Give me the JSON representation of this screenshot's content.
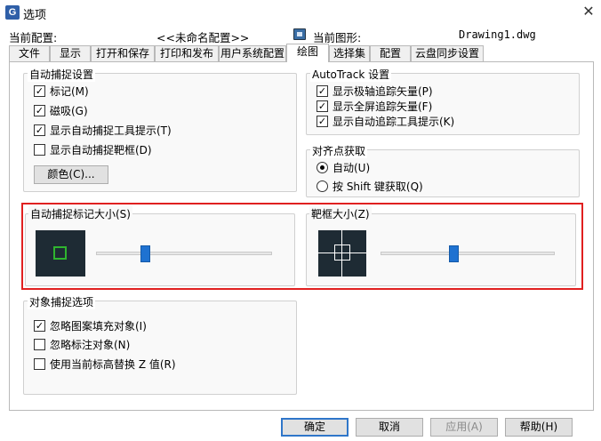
{
  "window": {
    "title": "选项",
    "close": "✕"
  },
  "header": {
    "profile_label": "当前配置:",
    "profile_value": "<<未命名配置>>",
    "drawing_label": "当前图形:",
    "drawing_value": "Drawing1.dwg"
  },
  "tabs": [
    {
      "label": "文件"
    },
    {
      "label": "显示"
    },
    {
      "label": "打开和保存"
    },
    {
      "label": "打印和发布"
    },
    {
      "label": "用户系统配置"
    },
    {
      "label": "绘图",
      "active": true
    },
    {
      "label": "选择集"
    },
    {
      "label": "配置"
    },
    {
      "label": "云盘同步设置"
    }
  ],
  "autosnap": {
    "title": "自动捕捉设置",
    "options": [
      {
        "label": "标记(M)",
        "checked": true
      },
      {
        "label": "磁吸(G)",
        "checked": true
      },
      {
        "label": "显示自动捕捉工具提示(T)",
        "checked": true
      },
      {
        "label": "显示自动捕捉靶框(D)",
        "checked": false
      }
    ],
    "color_button": "颜色(C)..."
  },
  "autotrack": {
    "title": "AutoTrack 设置",
    "options": [
      {
        "label": "显示极轴追踪矢量(P)",
        "checked": true
      },
      {
        "label": "显示全屏追踪矢量(F)",
        "checked": true
      },
      {
        "label": "显示自动追踪工具提示(K)",
        "checked": true
      }
    ]
  },
  "alignment": {
    "title": "对齐点获取",
    "options": [
      {
        "label": "自动(U)",
        "selected": true
      },
      {
        "label": "按 Shift 键获取(Q)",
        "selected": false
      }
    ]
  },
  "marker_size": {
    "title": "自动捕捉标记大小(S)",
    "level": 0.28
  },
  "aperture_size": {
    "title": "靶框大小(Z)",
    "level": 0.42
  },
  "object_snap": {
    "title": "对象捕捉选项",
    "options": [
      {
        "label": "忽略图案填充对象(I)",
        "checked": true
      },
      {
        "label": "忽略标注对象(N)",
        "checked": false
      },
      {
        "label": "使用当前标高替换 Z 值(R)",
        "checked": false
      }
    ]
  },
  "footer": {
    "ok": "确定",
    "cancel": "取消",
    "apply": "应用(A)",
    "help": "帮助(H)"
  },
  "colors": {
    "accent": "#1f72d1",
    "highlight": "#e02020",
    "preview_bg": "#1e2b34",
    "marker": "#2fb52f"
  }
}
